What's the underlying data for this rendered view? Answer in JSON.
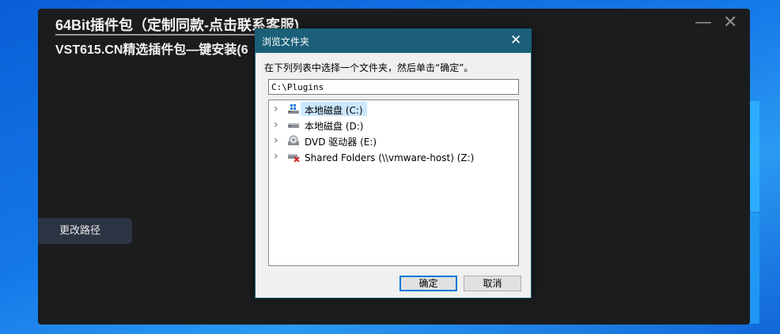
{
  "installer": {
    "title": "64Bit插件包（定制同款-点击联系客服)",
    "subtitle": "VST615.CN精选插件包—键安装(6",
    "minimize": "—",
    "close": "✕",
    "change_path_button": "更改路径"
  },
  "dialog": {
    "title": "浏览文件夹",
    "close": "✕",
    "prompt": "在下列列表中选择一个文件夹，然后单击“确定”。",
    "path_value": "C:\\Plugins",
    "tree_items": [
      {
        "label": "本地磁盘 (C:)",
        "icon": "windows-drive-icon",
        "selected": true
      },
      {
        "label": "本地磁盘 (D:)",
        "icon": "hard-drive-icon",
        "selected": false
      },
      {
        "label": "DVD 驱动器 (E:)",
        "icon": "dvd-drive-icon",
        "selected": false
      },
      {
        "label": "Shared Folders (\\\\vmware-host) (Z:)",
        "icon": "network-drive-disconnected-icon",
        "selected": false
      }
    ],
    "ok_button": "确定",
    "cancel_button": "取消"
  },
  "colors": {
    "desktop_blue": "#1578e8",
    "installer_bg": "#1b1c1e",
    "dialog_titlebar": "#1b5f78",
    "selection": "#cce8ff",
    "ok_border": "#0078d7"
  }
}
